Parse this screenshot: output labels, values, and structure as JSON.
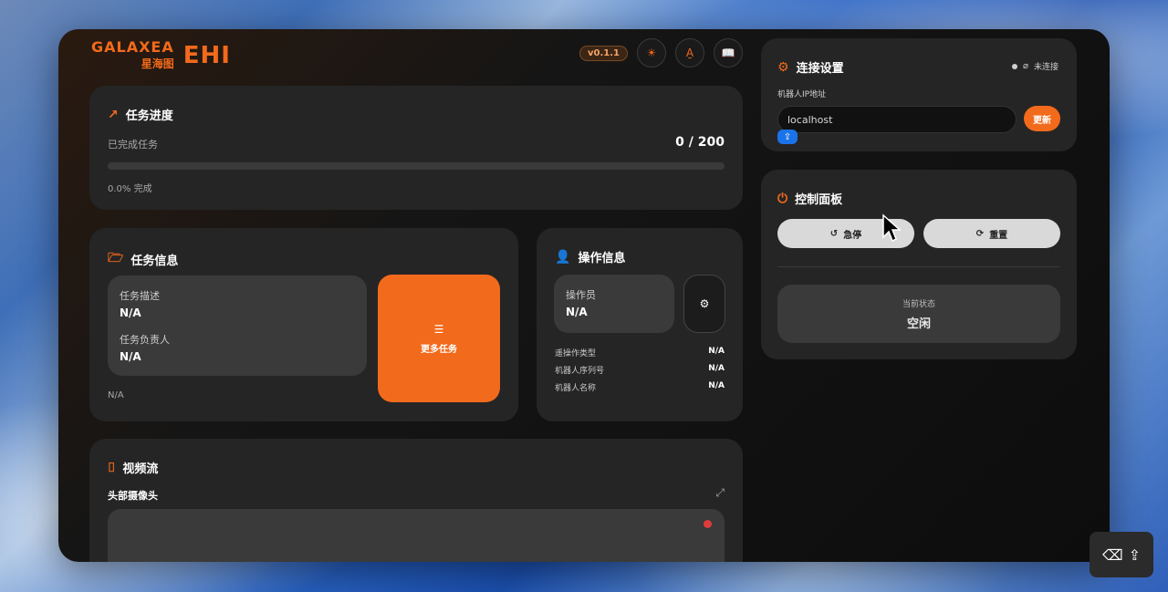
{
  "header": {
    "logo_main": "GALAXEA",
    "logo_sub": "星海图",
    "logo_product": "EHI",
    "version": "v0.1.1",
    "icons": [
      "sun-icon",
      "translate-icon",
      "book-icon"
    ]
  },
  "task_progress": {
    "title": "任务进度",
    "completed_label": "已完成任务",
    "count": "0 / 200",
    "progress_fraction": 0.0,
    "percent_label": "0.0% 完成"
  },
  "task_info": {
    "title": "任务信息",
    "desc_label": "任务描述",
    "desc_value": "N/A",
    "owner_label": "任务负责人",
    "owner_value": "N/A",
    "footer_value": "N/A",
    "more_tasks_label": "更多任务"
  },
  "operation_info": {
    "title": "操作信息",
    "operator_label": "操作员",
    "operator_value": "N/A",
    "rows": [
      {
        "key": "遥操作类型",
        "value": "N/A"
      },
      {
        "key": "机器人序列号",
        "value": "N/A"
      },
      {
        "key": "机器人名称",
        "value": "N/A"
      }
    ]
  },
  "video_stream": {
    "title": "视频流",
    "camera_label": "头部摄像头"
  },
  "connection": {
    "title": "连接设置",
    "status_text": "未连接",
    "ip_label": "机器人IP地址",
    "ip_value": "localhost",
    "update_label": "更新"
  },
  "control_panel": {
    "title": "控制面板",
    "estop_label": "急停",
    "reset_label": "重置",
    "state_label": "当前状态",
    "state_value": "空闲"
  },
  "colors": {
    "accent": "#f26a1b",
    "card": "#252525",
    "record_dot": "#e03b3b"
  }
}
